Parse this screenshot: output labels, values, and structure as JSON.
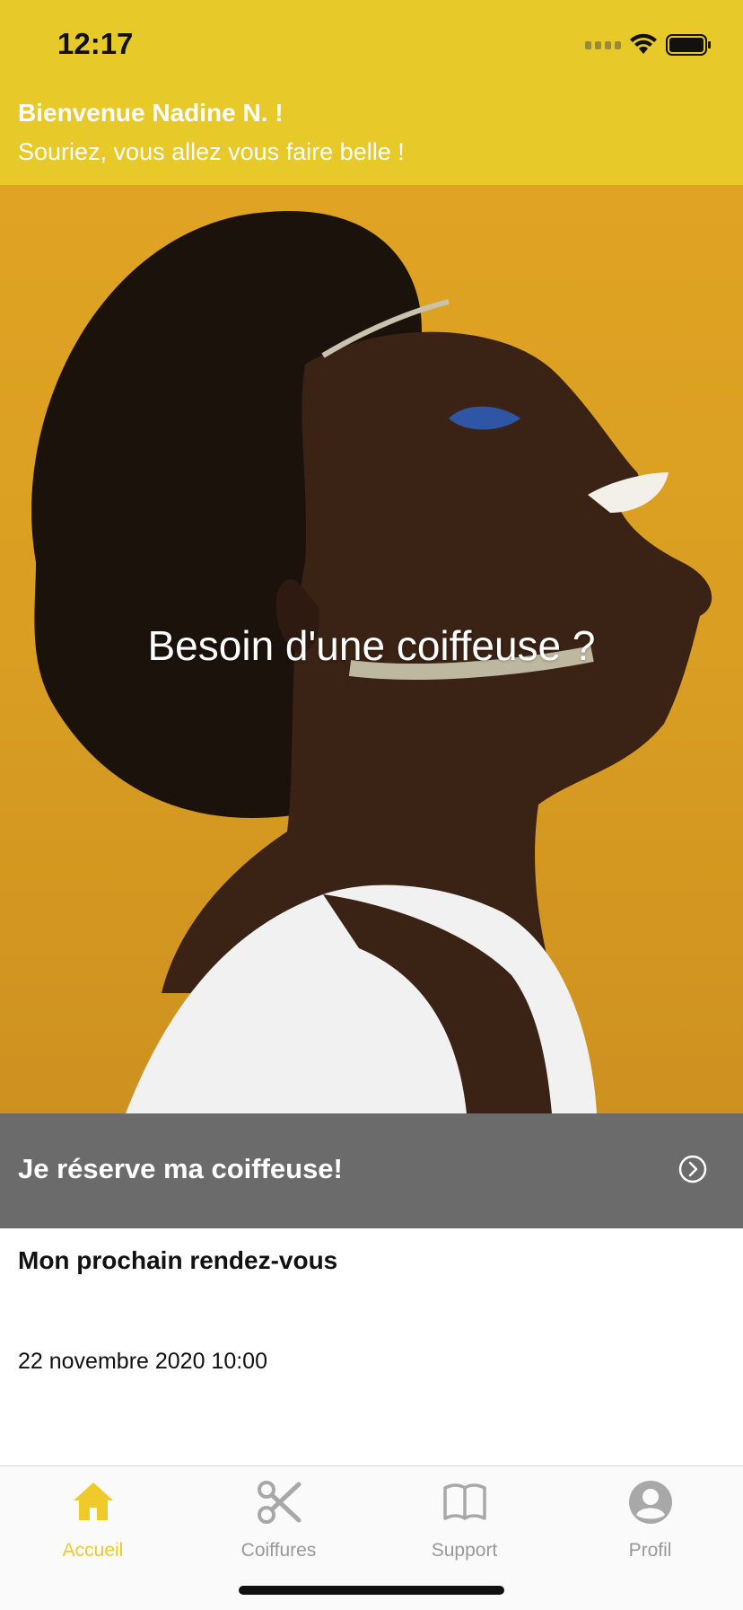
{
  "status_bar": {
    "time": "12:17"
  },
  "header": {
    "welcome": "Bienvenue Nadine N. !",
    "tagline": "Souriez, vous allez vous faire belle !"
  },
  "hero": {
    "title": "Besoin d'une coiffeuse ?"
  },
  "reserve_button": {
    "label": "Je réserve ma coiffeuse!",
    "icon": "chevron-right-circle-icon"
  },
  "next_appointment": {
    "title": "Mon prochain rendez-vous",
    "date": "22 novembre 2020 10:00"
  },
  "tab_bar": {
    "tabs": [
      {
        "label": "Accueil",
        "icon": "home-icon",
        "active": true
      },
      {
        "label": "Coiffures",
        "icon": "scissors-icon",
        "active": false
      },
      {
        "label": "Support",
        "icon": "book-icon",
        "active": false
      },
      {
        "label": "Profil",
        "icon": "user-icon",
        "active": false
      }
    ]
  },
  "colors": {
    "accent": "#E8C92A",
    "active_tab": "#F0C92B",
    "inactive_tab": "#999999",
    "reserve_bg": "#6b6b6b"
  }
}
